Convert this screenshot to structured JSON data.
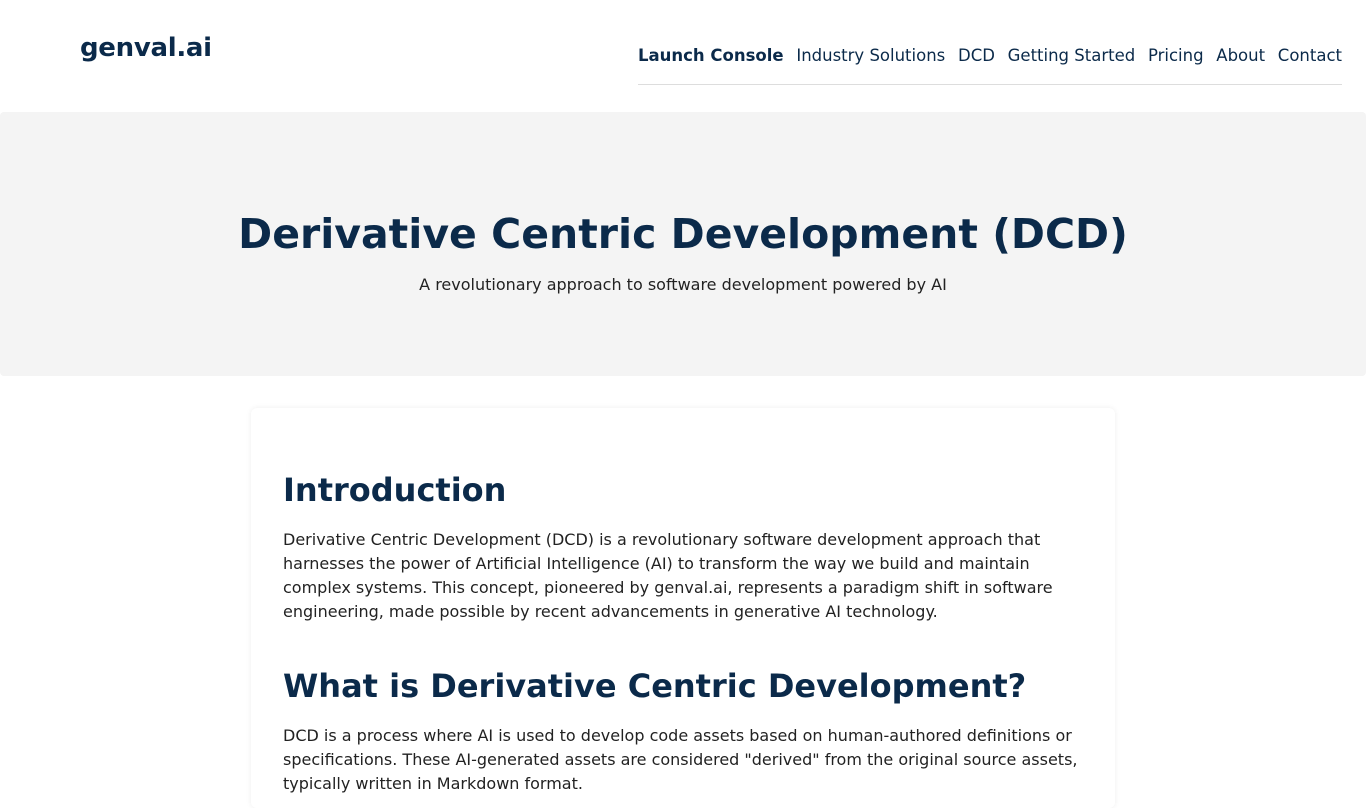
{
  "brand": {
    "name": "genval.ai",
    "accent": "#0b2a4a"
  },
  "nav": {
    "items": [
      {
        "label": "Launch Console"
      },
      {
        "label": "Industry Solutions"
      },
      {
        "label": "DCD"
      },
      {
        "label": "Getting Started"
      },
      {
        "label": "Pricing"
      },
      {
        "label": "About"
      },
      {
        "label": "Contact"
      }
    ]
  },
  "hero": {
    "title": "Derivative Centric Development (DCD)",
    "subtitle": "A revolutionary approach to software development powered by AI"
  },
  "content": {
    "intro_heading": "Introduction",
    "intro_text": "Derivative Centric Development (DCD) is a revolutionary software development approach that harnesses the power of Artificial Intelligence (AI) to transform the way we build and maintain complex systems. This concept, pioneered by genval.ai, represents a paradigm shift in software engineering, made possible by recent advancements in generative AI technology.",
    "what_heading": "What is Derivative Centric Development?",
    "what_text": "DCD is a process where AI is used to develop code assets based on human-authored definitions or specifications. These AI-generated assets are considered \"derived\" from the original source assets, typically written in Markdown format."
  }
}
